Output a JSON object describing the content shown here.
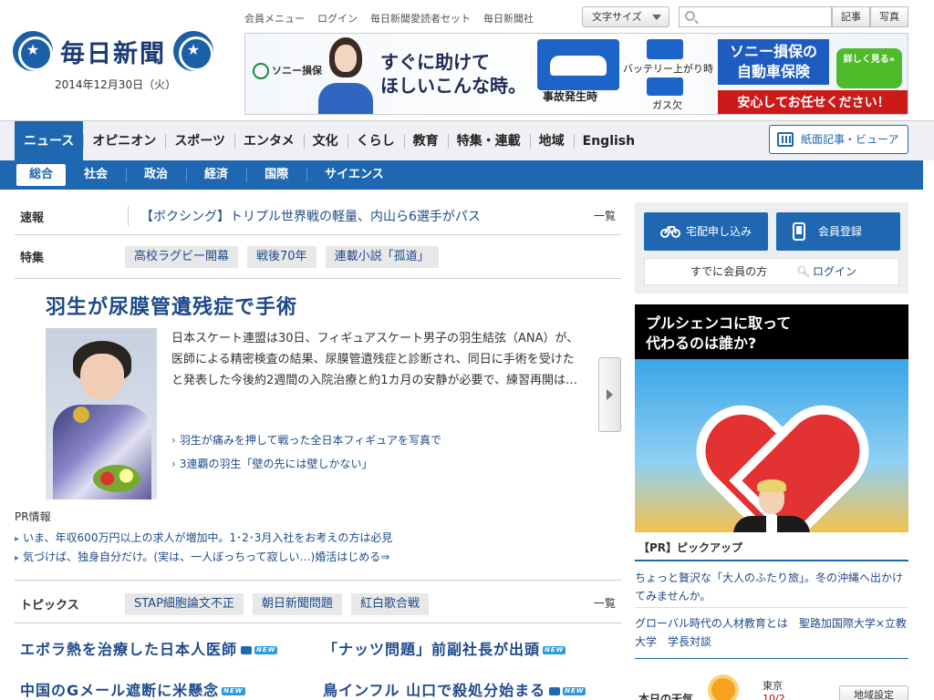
{
  "brand": {
    "name": "毎日新聞",
    "date": "2014年12月30日（火）"
  },
  "top_links": [
    "会員メニュー",
    "ログイン",
    "毎日新聞愛読者セット",
    "毎日新聞社"
  ],
  "tools": {
    "font_size_label": "文字サイズ",
    "search_placeholder": "",
    "search_btn1": "記事",
    "search_btn2": "写真"
  },
  "ad": {
    "sponsor": "ソニー損保",
    "copy_line1": "すぐに助けて",
    "copy_line2": "ほしいこんな時。",
    "accident": "事故発生時",
    "battery": "バッテリー上がり時",
    "gas": "ガス欠",
    "brand_line1": "ソニー損保の",
    "brand_line2": "自動車保険",
    "details": "詳しく見る»",
    "tagline": "安心してお任せください！"
  },
  "main_nav": [
    "ニュース",
    "オピニオン",
    "スポーツ",
    "エンタメ",
    "文化",
    "くらし",
    "教育",
    "特集・連載",
    "地域",
    "English"
  ],
  "viewer_label": "紙面記事・ビューアー",
  "sub_nav": [
    "総合",
    "社会",
    "政治",
    "経済",
    "国際",
    "サイエンス"
  ],
  "breaking": {
    "label": "速報",
    "text": "【ボクシング】トリプル世界戦の軽量、内山ら6選手がパス",
    "more": "一覧"
  },
  "features": {
    "label": "特集",
    "tags": [
      "高校ラグビー開幕",
      "戦後70年",
      "連載小説「孤道」"
    ]
  },
  "lead": {
    "headline": "羽生が尿膜管遺残症で手術",
    "body": "日本スケート連盟は30日、フィギュアスケート男子の羽生結弦（ANA）が、医師による精密検査の結果、尿膜管遺残症と診断され、同日に手術を受けたと発表した今後約2週間の入院治療と約1カ月の安静が必要で、練習再開は…",
    "related": [
      "羽生が痛みを押して戦った全日本フィギュアを写真で",
      "3連覇の羽生「壁の先には壁しかない」"
    ]
  },
  "pr": {
    "label": "PR情報",
    "lines": [
      "いま、年収600万円以上の求人が増加中。1･2･3月入社をお考えの方は必見",
      "気づけば、独身自分だけ。(実は、一人ぼっちって寂しい…)婚活はじめる⇒"
    ]
  },
  "topics": {
    "label": "トピックス",
    "tags": [
      "STAP細胞論文不正",
      "朝日新聞問題",
      "紅白歌合戦"
    ],
    "more": "一覧"
  },
  "news": [
    "エボラ熱を治療した日本人医師",
    "「ナッツ問題」前副社長が出頭",
    "中国のGメール遮断に米懸念",
    "鳥インフル 山口で殺処分始まる"
  ],
  "new_badge": "NEW",
  "sidebar": {
    "delivery_btn": "宅配申し込み",
    "member_btn": "会員登録",
    "already_member": "すでに会員の方",
    "login": "ログイン",
    "pr_caption_1": "プルシェンコに取って",
    "pr_caption_2": "代わるのは誰か?",
    "pickup_label": "【PR】ピックアップ",
    "pickup_1": "ちょっと贅沢な「大人のふたり旅」。冬の沖縄へ出かけてみませんか。",
    "pickup_2": "グローバル時代の人材教育とは　聖路加国際大学×立教大学　学長対談",
    "weather_label": "本日の天気",
    "city": "東京",
    "temp": "10/2",
    "area_btn": "地域設定"
  }
}
